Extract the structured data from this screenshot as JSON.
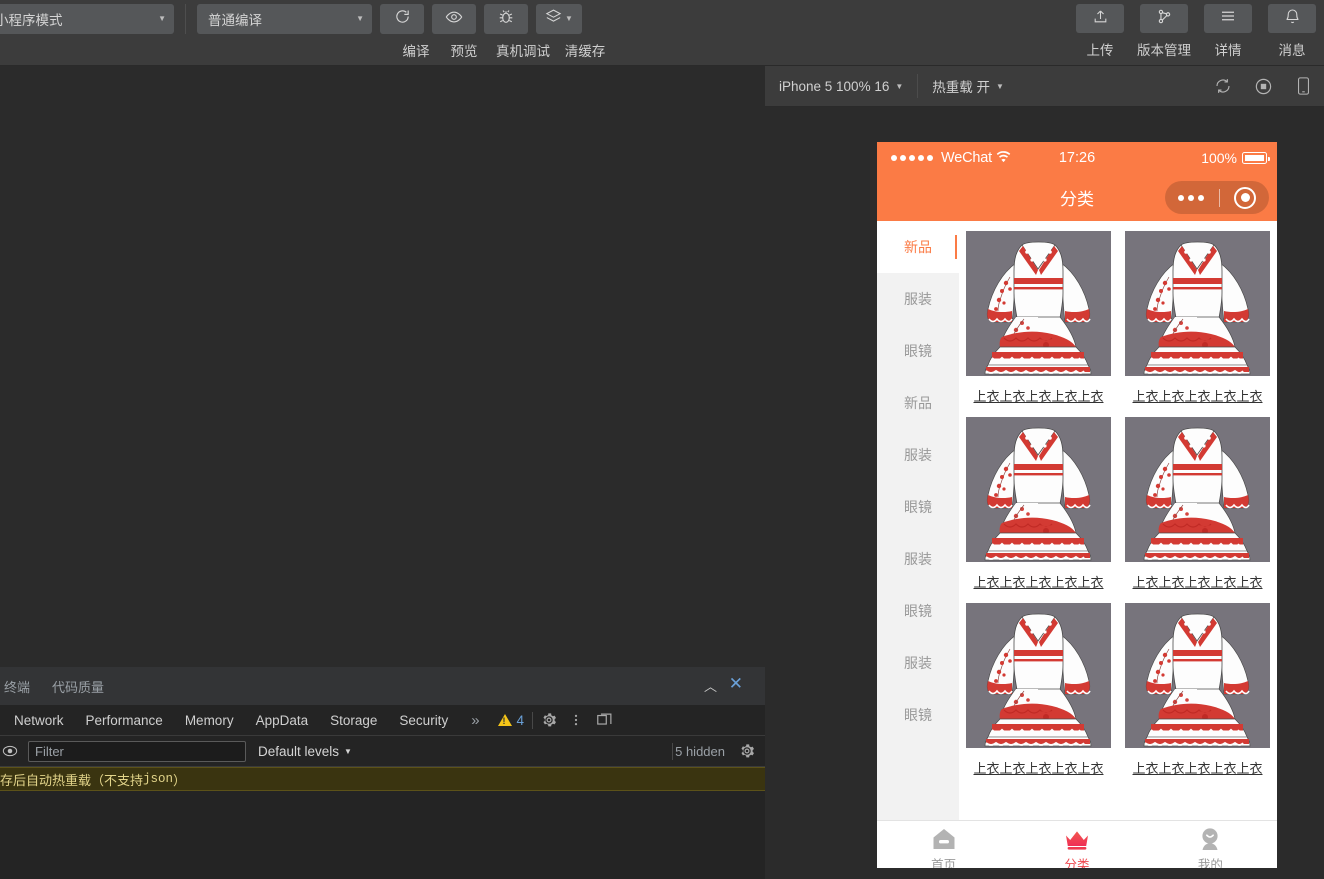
{
  "toolbar": {
    "mode_select": "小程序模式",
    "compile_select": "普通编译",
    "buttons": [
      {
        "label": "编译",
        "icon": "refresh-icon"
      },
      {
        "label": "预览",
        "icon": "eye-icon"
      },
      {
        "label": "真机调试",
        "icon": "bug-icon"
      },
      {
        "label": "清缓存",
        "icon": "layers-icon"
      }
    ],
    "right_buttons": [
      {
        "label": "上传",
        "icon": "upload-icon"
      },
      {
        "label": "版本管理",
        "icon": "branch-icon"
      },
      {
        "label": "详情",
        "icon": "hamburger-icon"
      },
      {
        "label": "消息",
        "icon": "bell-icon"
      }
    ]
  },
  "devtools": {
    "header_tabs": [
      "终端",
      "代码质量"
    ],
    "collapse_icon": "chevron-up-icon",
    "close_icon": "close-icon",
    "tabs": [
      "Network",
      "Performance",
      "Memory",
      "AppData",
      "Storage",
      "Security"
    ],
    "more_icon": "chevron-double-right-icon",
    "warning_count": "4",
    "filter_placeholder": "Filter",
    "levels_label": "Default levels",
    "hidden_label": "5 hidden",
    "console_message_prefix": "存后自动热重载（不支持 ",
    "console_message_mono": "json",
    "console_message_suffix": "）"
  },
  "simulator": {
    "device_select": "iPhone 5 100% 16",
    "hotreload_select": "热重载 开",
    "icons": [
      "refresh-icon",
      "record-stop-icon",
      "device-icon"
    ]
  },
  "phone": {
    "status": {
      "carrier": "WeChat",
      "time": "17:26",
      "battery_pct": "100%"
    },
    "nav_title": "分类",
    "categories": [
      {
        "label": "新品",
        "active": true
      },
      {
        "label": "服装",
        "active": false
      },
      {
        "label": "眼镜",
        "active": false
      },
      {
        "label": "新品",
        "active": false
      },
      {
        "label": "服装",
        "active": false
      },
      {
        "label": "眼镜",
        "active": false
      },
      {
        "label": "服装",
        "active": false
      },
      {
        "label": "眼镜",
        "active": false
      },
      {
        "label": "服装",
        "active": false
      },
      {
        "label": "眼镜",
        "active": false
      }
    ],
    "goods": [
      {
        "name": "上衣上衣上衣上衣上衣"
      },
      {
        "name": "上衣上衣上衣上衣上衣"
      },
      {
        "name": "上衣上衣上衣上衣上衣"
      },
      {
        "name": "上衣上衣上衣上衣上衣"
      },
      {
        "name": "上衣上衣上衣上衣上衣"
      },
      {
        "name": "上衣上衣上衣上衣上衣"
      }
    ],
    "tabbar": [
      {
        "label": "首页",
        "icon": "home-icon",
        "active": false
      },
      {
        "label": "分类",
        "icon": "crown-icon",
        "active": true
      },
      {
        "label": "我的",
        "icon": "person-icon",
        "active": false
      }
    ]
  },
  "colors": {
    "brand_orange": "#FB7B45",
    "tab_active_red": "#f0484f",
    "warning_yellow": "#f5c518",
    "link_blue": "#6aa0d8"
  }
}
